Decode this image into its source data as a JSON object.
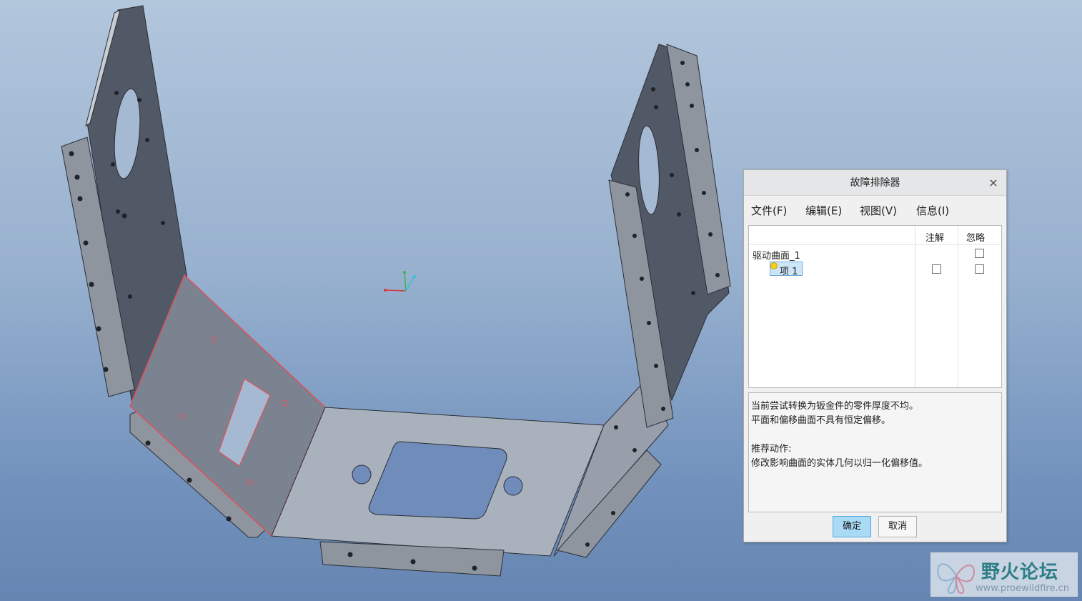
{
  "dialog": {
    "title": "故障排除器",
    "close": "×",
    "menu": [
      {
        "label": "文件(F)"
      },
      {
        "label": "编辑(E)"
      },
      {
        "label": "视图(V)"
      },
      {
        "label": "信息(I)"
      }
    ],
    "columns": {
      "annotate": "注解",
      "ignore": "忽略"
    },
    "tree": {
      "root": "驱动曲面_1",
      "child": "项 1"
    },
    "message": {
      "line1": "当前尝试转换为钣金件的零件厚度不均。",
      "line2": "平面和偏移曲面不具有恒定偏移。",
      "heading": "推荐动作:",
      "line3": "修改影响曲面的实体几何以归一化偏移值。"
    },
    "buttons": {
      "ok": "确定",
      "cancel": "取消"
    }
  },
  "watermark": {
    "cn": "野火论坛",
    "url": "www.proewildfire.cn"
  },
  "colors": {
    "background_top": "#b2c6dc",
    "background_bottom": "#6685b2",
    "part_dark": "#4f5563",
    "part_light": "#a9b1bd",
    "selection_edge": "#e0505a",
    "ok_button": "#a9daf6"
  },
  "icons": {
    "close": "close-icon",
    "tree_item": "status-dot-icon",
    "axes": "coordinate-axes-icon",
    "logo": "butterfly-logo-icon"
  }
}
